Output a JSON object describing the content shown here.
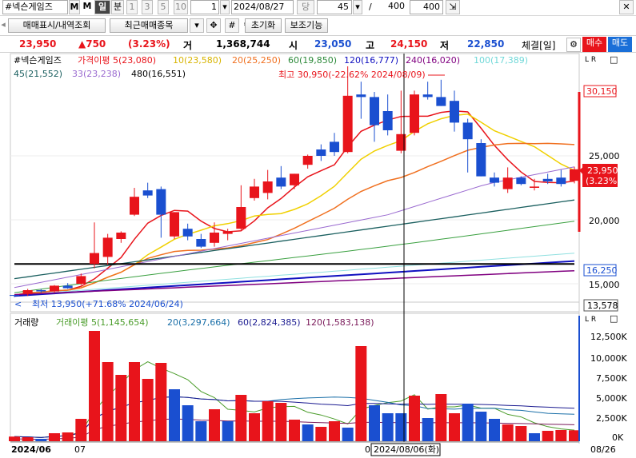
{
  "toolbar": {
    "stock_name": "#넥슨게임즈",
    "btn_m": "M",
    "btn_day": "일",
    "btn_min": "분",
    "period_1": "1",
    "period_3": "3",
    "period_5": "5",
    "period_10": "10",
    "date": "2024/08/27",
    "btn_dang": "당",
    "count1": "45",
    "slash": "/",
    "count2": "400",
    "count3": "400"
  },
  "row2": {
    "trade_btn": "매매표시/내역조회",
    "recent_btn": "최근매매종목",
    "hash": "#",
    "reset_btn": "초기화",
    "assist_btn": "보조기능"
  },
  "quote": {
    "price": "23,950",
    "change": "▲750",
    "rate": "(3.23%)",
    "vol_label": "거",
    "volume": "1,368,744",
    "open_label": "시",
    "open": "23,050",
    "high_label": "고",
    "high": "24,150",
    "low_label": "저",
    "low": "22,850",
    "conclude": "체결[일]",
    "buy": "매수",
    "sell": "매도"
  },
  "legend": {
    "name": "#넥슨게임즈",
    "ma5": "가격이평 5(23,080)",
    "ma10": "10(23,580)",
    "ma20": "20(25,250)",
    "ma60": "60(19,850)",
    "ma120": "120(16,777)",
    "ma240": "240(16,020)",
    "ma100": "100(17,389)",
    "ma45": "45(21,552)",
    "ma33": "33(23,238)",
    "ma480": "480(16,551)",
    "btn_lr": "L R",
    "btn_box": "□"
  },
  "annot": {
    "high": "최고 30,950(-22.62% 2024/08/09)",
    "low": "최저 13,950(+71.68% 2024/06/24)"
  },
  "price_axis": {
    "t25000": "25,000",
    "t20000": "20,000",
    "t15000": "15,000",
    "hi_tag": "30,150",
    "cur_tag1": "23,950",
    "cur_tag2": "(3.23%)",
    "low_tag": "16,250",
    "min_tag": "13,578"
  },
  "vlegend": {
    "name": "거래량",
    "ma5": "거래이평 5(1,145,654)",
    "ma20": "20(3,297,664)",
    "ma60": "60(2,824,385)",
    "ma120": "120(1,583,138)"
  },
  "vol_axis": {
    "v12500": "12,500K",
    "v10000": "10,000K",
    "v7500": "7,500K",
    "v5000": "5,000K",
    "v2500": "2,500K",
    "v0": "0K"
  },
  "xaxis": {
    "d1": "2024/06",
    "d2": "07",
    "d3": "0",
    "cross_date": "2024/08/06(화)",
    "end": "08/26"
  },
  "colors": {
    "up": "#e8141b",
    "down": "#1a4fd0",
    "ma5": "#e8141b",
    "ma10": "#f0d000",
    "ma20": "#f07020",
    "ma60": "#2d6b6b",
    "ma120": "#1010c0",
    "ma240": "#800080",
    "ma100": "#90e0e0",
    "ma45": "#1a5f5f",
    "ma33": "#9a6ad0",
    "ma480": "#000000"
  },
  "chart_data": {
    "type": "candlestick",
    "dates_shown": [
      "2024/06",
      "07",
      "2024/08/06(화)",
      "08/26"
    ],
    "candles": [
      [
        14120,
        14120,
        13950,
        14100
      ],
      [
        14200,
        14600,
        14050,
        14500
      ],
      [
        14500,
        14600,
        14300,
        14400
      ],
      [
        14400,
        14900,
        14300,
        14850
      ],
      [
        14850,
        15050,
        14600,
        14650
      ],
      [
        15000,
        15800,
        14900,
        15600
      ],
      [
        16550,
        19800,
        16200,
        17400
      ],
      [
        17100,
        18900,
        16500,
        18600
      ],
      [
        18500,
        19100,
        18200,
        19000
      ],
      [
        20400,
        22500,
        20300,
        21800
      ],
      [
        22300,
        22900,
        21700,
        21900
      ],
      [
        22400,
        22600,
        18600,
        20400
      ],
      [
        18700,
        20600,
        18500,
        20600
      ],
      [
        19300,
        19700,
        18400,
        18700
      ],
      [
        18500,
        18900,
        17800,
        17900
      ],
      [
        18200,
        19800,
        17900,
        19000
      ],
      [
        18900,
        19300,
        18400,
        19100
      ],
      [
        19300,
        22700,
        19200,
        21000
      ],
      [
        21700,
        23200,
        21500,
        22600
      ],
      [
        22100,
        23900,
        21600,
        23000
      ],
      [
        23300,
        24200,
        22400,
        22600
      ],
      [
        22700,
        23600,
        22400,
        23600
      ],
      [
        24300,
        25100,
        24000,
        25000
      ],
      [
        25500,
        25900,
        24600,
        25000
      ],
      [
        26100,
        26800,
        25000,
        25300
      ],
      [
        25300,
        32000,
        25200,
        29700
      ],
      [
        29800,
        30800,
        27900,
        29600
      ],
      [
        29600,
        30000,
        26100,
        27400
      ],
      [
        28500,
        29800,
        26600,
        27000
      ],
      [
        25400,
        30100,
        25200,
        26700
      ],
      [
        26800,
        30100,
        26600,
        29800
      ],
      [
        29800,
        30800,
        29400,
        29600
      ],
      [
        29600,
        30950,
        28900,
        28900
      ],
      [
        29300,
        30100,
        26900,
        27600
      ],
      [
        27600,
        27900,
        23700,
        26300
      ],
      [
        26000,
        26300,
        23400,
        23400
      ],
      [
        23300,
        23700,
        22600,
        22900
      ],
      [
        22400,
        24100,
        22100,
        23300
      ],
      [
        23300,
        23400,
        22700,
        22800
      ],
      [
        22500,
        23200,
        22300,
        22600
      ],
      [
        23200,
        23600,
        22800,
        23000
      ],
      [
        23300,
        23900,
        22600,
        22800
      ],
      [
        23050,
        24150,
        22850,
        23950
      ]
    ],
    "volume": [
      [
        580,
        "up"
      ],
      [
        500,
        "up"
      ],
      [
        300,
        "down"
      ],
      [
        1000,
        "up"
      ],
      [
        1100,
        "up"
      ],
      [
        2800,
        "up"
      ],
      [
        13800,
        "up"
      ],
      [
        9900,
        "up"
      ],
      [
        8300,
        "up"
      ],
      [
        9900,
        "up"
      ],
      [
        7800,
        "up"
      ],
      [
        9800,
        "up"
      ],
      [
        6500,
        "down"
      ],
      [
        4500,
        "down"
      ],
      [
        2500,
        "down"
      ],
      [
        4000,
        "up"
      ],
      [
        2500,
        "down"
      ],
      [
        5800,
        "up"
      ],
      [
        3500,
        "up"
      ],
      [
        5000,
        "up"
      ],
      [
        4800,
        "up"
      ],
      [
        2700,
        "up"
      ],
      [
        2100,
        "down"
      ],
      [
        1800,
        "up"
      ],
      [
        2500,
        "up"
      ],
      [
        1700,
        "down"
      ],
      [
        11900,
        "up"
      ],
      [
        4500,
        "down"
      ],
      [
        3500,
        "down"
      ],
      [
        3500,
        "down"
      ],
      [
        5700,
        "up"
      ],
      [
        2900,
        "down"
      ],
      [
        5900,
        "up"
      ],
      [
        3500,
        "up"
      ],
      [
        4700,
        "down"
      ],
      [
        3700,
        "down"
      ],
      [
        2800,
        "down"
      ],
      [
        2100,
        "up"
      ],
      [
        1900,
        "up"
      ],
      [
        1000,
        "down"
      ],
      [
        1300,
        "up"
      ],
      [
        1400,
        "up"
      ],
      [
        1369,
        "up"
      ]
    ],
    "price_ylim": [
      13578,
      30950
    ],
    "volume_ylim": [
      0,
      13800
    ]
  }
}
